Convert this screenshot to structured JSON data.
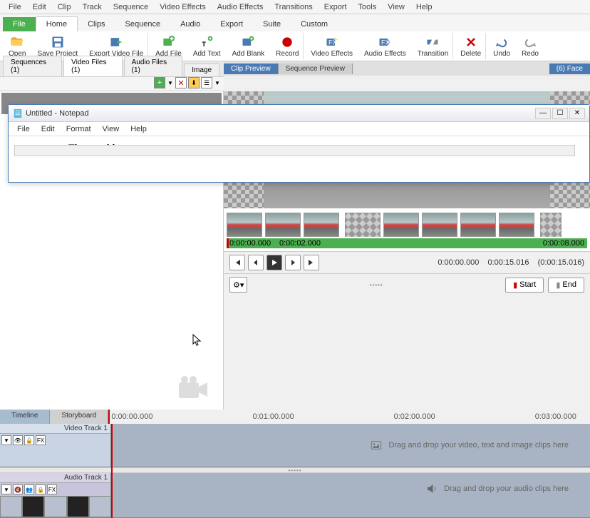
{
  "menubar": [
    "File",
    "Edit",
    "Clip",
    "Track",
    "Sequence",
    "Video Effects",
    "Audio Effects",
    "Transitions",
    "Export",
    "Tools",
    "View",
    "Help"
  ],
  "ribbon_tabs": {
    "file": "File",
    "items": [
      "Home",
      "Clips",
      "Sequence",
      "Audio",
      "Export",
      "Suite",
      "Custom"
    ]
  },
  "ribbon": {
    "open": "Open",
    "save": "Save Project",
    "export_vid": "Export Video File",
    "add_file": "Add File",
    "add_text": "Add Text",
    "add_blank": "Add Blank",
    "record": "Record",
    "video_fx": "Video Effects",
    "audio_fx": "Audio Effects",
    "transition": "Transition",
    "delete": "Delete",
    "undo": "Undo",
    "redo": "Redo"
  },
  "file_tabs": [
    {
      "label": "Sequences (1)"
    },
    {
      "label": "Video Files (1)",
      "active": true
    },
    {
      "label": "Audio Files (1)"
    },
    {
      "label": "Image"
    }
  ],
  "preview_tabs": {
    "clip": "Clip Preview",
    "seq": "Sequence Preview",
    "right": "(6) Face"
  },
  "clip_times": {
    "t0": "0:00:00.000",
    "t1": "0:00:02.000",
    "t2": "0:00:08.000"
  },
  "playback": {
    "cur": "0:00:00.000",
    "end": "0:00:15.016",
    "dur": "(0:00:15.016)",
    "start_btn": "Start",
    "end_btn": "End"
  },
  "timeline": {
    "tab1": "Timeline",
    "tab2": "Storyboard",
    "ruler": [
      "0:00:00.000",
      "0:01:00.000",
      "0:02:00.000",
      "0:03:00.000"
    ]
  },
  "tracks": {
    "video_label": "Video Track 1",
    "audio_label": "Audio Track 1",
    "video_hint": "Drag and drop your video, text and image clips here",
    "audio_hint": "Drag and drop your audio clips here"
  },
  "notepad": {
    "title": "Untitled - Notepad",
    "menu": [
      "File",
      "Edit",
      "Format",
      "View",
      "Help"
    ],
    "watermark": "Thecrackbox.com"
  }
}
